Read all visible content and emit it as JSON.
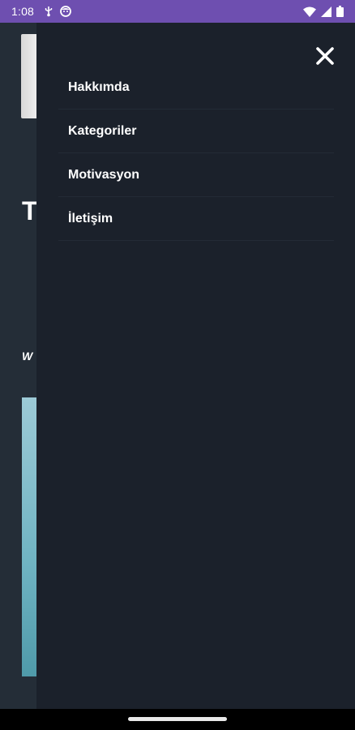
{
  "status_bar": {
    "time": "1:08",
    "icons": [
      "usb-debug-icon",
      "face-icon",
      "wifi-icon",
      "signal-icon",
      "battery-icon"
    ],
    "background": "#6e4fb0"
  },
  "background_page": {
    "title_fragment": "T",
    "subtitle_fragment": "W"
  },
  "drawer": {
    "background": "#1b212b",
    "close_icon": "close-icon",
    "items": [
      {
        "label": "Hakkımda"
      },
      {
        "label": "Kategoriler"
      },
      {
        "label": "Motivasyon"
      },
      {
        "label": "İletişim"
      }
    ]
  }
}
